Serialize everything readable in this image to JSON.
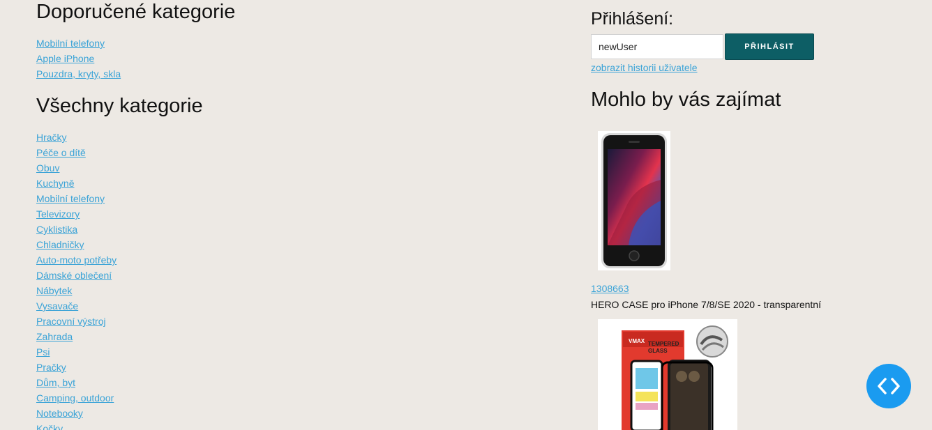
{
  "recommended": {
    "title": "Doporučené kategorie",
    "items": [
      "Mobilní telefony",
      "Apple iPhone",
      "Pouzdra, kryty, skla"
    ]
  },
  "all_categories": {
    "title": "Všechny kategorie",
    "items": [
      "Hračky",
      "Péče o dítě",
      "Obuv",
      "Kuchyně",
      "Mobilní telefony",
      "Televizory",
      "Cyklistika",
      "Chladničky",
      "Auto-moto potřeby",
      "Dámské oblečení",
      "Nábytek",
      "Vysavače",
      "Pracovní výstroj",
      "Zahrada",
      "Psi",
      "Pračky",
      "Dům, byt",
      "Camping, outdoor",
      "Notebooky",
      "Kočky"
    ]
  },
  "login": {
    "title": "Přihlášení:",
    "username_value": "newUser",
    "button_label": "PŘIHLÁSIT",
    "history_link": "zobrazit historii uživatele"
  },
  "suggestions": {
    "title": "Mohlo by vás zajímat",
    "products": [
      {
        "id": "1308663",
        "name": "HERO CASE pro iPhone 7/8/SE 2020 - transparentní"
      }
    ]
  },
  "product2_image_text": {
    "brand": "VMAX",
    "label_line1": "TEMPERED",
    "label_line2": "GLASS"
  },
  "colors": {
    "background": "#ede9e4",
    "link": "#3aa3d7",
    "button": "#0d5e65",
    "floating_button": "#1a9bf0"
  },
  "icons": {
    "floating_button": "code-brackets-icon"
  }
}
